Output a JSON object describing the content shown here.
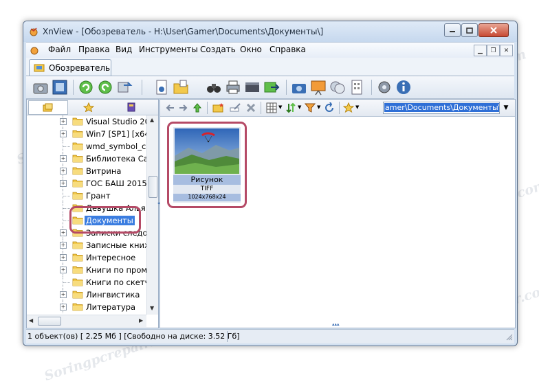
{
  "window": {
    "title": "XnView - [Обозреватель - H:\\User\\Gamer\\Documents\\Документы\\]"
  },
  "menu": {
    "items": [
      "Файл",
      "Правка",
      "Вид",
      "Инструменты",
      "Создать",
      "Окно",
      "Справка"
    ]
  },
  "tabs": [
    {
      "label": "Обозреватель"
    }
  ],
  "tree": {
    "items": [
      {
        "label": "Visual Studio 20",
        "expandable": true
      },
      {
        "label": "Win7 [SP1] [x64]",
        "expandable": true
      },
      {
        "label": "wmd_symbol_ca",
        "expandable": false
      },
      {
        "label": "Библиотека Cal",
        "expandable": true
      },
      {
        "label": "Витрина",
        "expandable": true
      },
      {
        "label": "ГОС БАШ 2015-",
        "expandable": true
      },
      {
        "label": "Грант",
        "expandable": false
      },
      {
        "label": "Девушка Алья",
        "expandable": false
      },
      {
        "label": "Документы",
        "expandable": false,
        "selected": true
      },
      {
        "label": "Записки следо",
        "expandable": true
      },
      {
        "label": "Записные книж",
        "expandable": true
      },
      {
        "label": "Интересное",
        "expandable": true
      },
      {
        "label": "Книги по пром",
        "expandable": true
      },
      {
        "label": "Книги по скетч",
        "expandable": false
      },
      {
        "label": "Лингвистика",
        "expandable": true
      },
      {
        "label": "Литература",
        "expandable": true
      }
    ]
  },
  "address": {
    "value": "amer\\Documents\\Документы\\"
  },
  "thumbnail": {
    "name": "Рисунок",
    "format": "TIFF",
    "dimensions": "1024x768x24"
  },
  "status": {
    "text": "1 объект(ов) [ 2.25 Мб ] [Свободно на диске: 3.52 Гб]"
  },
  "watermark": {
    "text": "Soringpcrepair.com"
  },
  "colors": {
    "callout": "#b54a66",
    "selection": "#3b7de0",
    "window_frame": "#d3e1f1"
  }
}
